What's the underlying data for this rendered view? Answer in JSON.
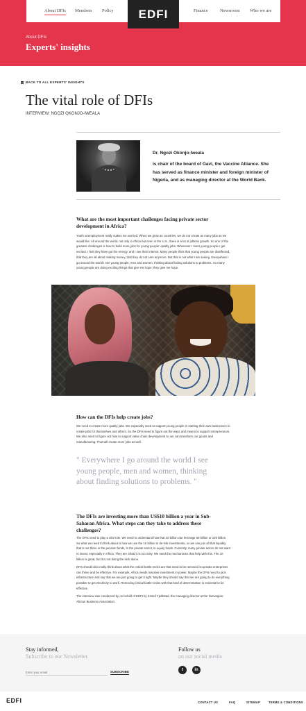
{
  "nav": {
    "left": [
      "About DFIs",
      "Members",
      "Policy"
    ],
    "right": [
      "Finance",
      "Newsroom",
      "Who we are"
    ],
    "logo": "EDFI"
  },
  "hero": {
    "kicker": "About DFIs",
    "title": "Experts' insights"
  },
  "back_link": "BACK TO ALL EXPERTS' INSIGHTS",
  "article": {
    "title": "The vital role of DFIs",
    "subtitle": "INTERVIEW: NGOZI OKONJO-IWEALA",
    "bio_name": "Dr. Ngozi Okonjo-Iweala",
    "bio_text": "is chair of the board of Gavi, the Vaccine Alliance. She has served as finance minister and foreign minister of Nigeria, and as managing director at the World Bank.",
    "q1": "What are the most important challenges facing private sector development in Africa?",
    "a1": "Youth unemployment really makes me worried. When we grow as countries, we do not create as many jobs as we would like. All around the world, not only in Africa but even in the U.S., there is a lot of jobless growth. So one of the greatest challenges is how to build more jobs for young people: quality jobs. Whenever I meet young people I get excited. I feel they have got the energy, and I see their interest. Many people think that young people are disaffected, that they are all about making money, that they do not care anymore. But that is not what I am seeing. Everywhere I go around the world I see young people, men and women, thinking about finding solutions to problems. So many young people are doing exciting things that give me hope; they give me hope.",
    "q2": "How can the DFIs help create jobs?",
    "a2": "We need to create more quality jobs. We especially need to support young people in starting their own businesses to create jobs for themselves and others. So the DFIs need to figure out the ways and means to support entrepreneurs. We also need to figure out how to support value chain development so we can transform our goods and manufacturing. That will create more jobs as well.",
    "quote": "\" Everywhere I go around the world I see young people, men and women, thinking about finding solutions to problems. \"",
    "q3": "The DFIs are investing more than US$10 billion a year in Sub-Saharan Africa. What steps can they take to address these challenges?",
    "a3": "The DFIs need to play a vital role. We need to understand how that 10 billion can leverage 50 billion or 100 billion. So what we need to think about is how we use the 10 billion to de-risk investments, so we can join all that liquidity that is out there in the pension funds, in the private sector, in equity funds. Currently, many private actors do not want to invest, especially in Africa. They are afraid it is too risky. We need the mechanisms that help with this. The 10 billion is great, but it is not doing the trick alone.",
    "a4": "DFIs should also really think about what the critical bottle-necks are that need to be removed so private enterprises can thrive and be effective. For example, Africa needs massive investment in power. Maybe the DFIs need to pick infrastructure and say that we are just going to get it right. Maybe they should say that we are going to do everything possible to get electricity to work. Removing critical bottle-necks with that kind of determination is essential to be effective.",
    "credit": "The interview was conducted by on behalf of EDFI by Kristof Fjeldstad, the managing director at the Norwegian-African Business Association."
  },
  "footer": {
    "stay_title": "Stay informed,",
    "stay_sub": "Subscribe to our Newsletter.",
    "email_placeholder": "Enter your email",
    "subscribe": "SUBSCRIBE",
    "follow_title": "Follow us",
    "follow_sub": "on our social media",
    "twitter": "t",
    "linkedin": "in"
  },
  "bottom": {
    "logo": "EDFI",
    "links": [
      "CONTACT US",
      "FAQ",
      "SITEMAP",
      "TERMS & CONDITIONS"
    ]
  }
}
